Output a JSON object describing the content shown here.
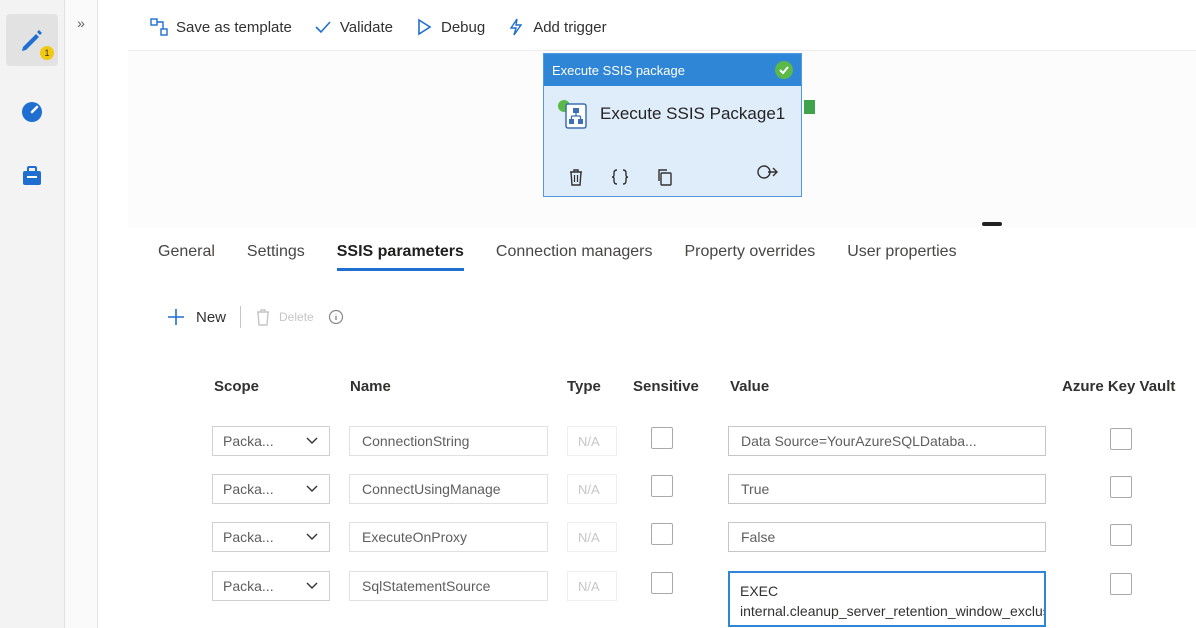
{
  "rail": {
    "badge": "1"
  },
  "toolbar": {
    "save_template": "Save as template",
    "validate": "Validate",
    "debug": "Debug",
    "add_trigger": "Add trigger"
  },
  "activity": {
    "type": "Execute SSIS package",
    "name": "Execute SSIS Package1"
  },
  "tabs": [
    {
      "label": "General"
    },
    {
      "label": "Settings"
    },
    {
      "label": "SSIS parameters"
    },
    {
      "label": "Connection managers"
    },
    {
      "label": "Property overrides"
    },
    {
      "label": "User properties"
    }
  ],
  "param_toolbar": {
    "new": "New",
    "delete": "Delete"
  },
  "columns": {
    "scope": "Scope",
    "name": "Name",
    "type": "Type",
    "sensitive": "Sensitive",
    "value": "Value",
    "akv": "Azure Key Vault"
  },
  "rows": [
    {
      "scope": "Packa...",
      "name": "ConnectionString",
      "type": "N/A",
      "value": "Data Source=YourAzureSQLDataba..."
    },
    {
      "scope": "Packa...",
      "name": "ConnectUsingManage",
      "type": "N/A",
      "value": "True"
    },
    {
      "scope": "Packa...",
      "name": "ExecuteOnProxy",
      "type": "N/A",
      "value": "False"
    },
    {
      "scope": "Packa...",
      "name": "SqlStatementSource",
      "type": "N/A",
      "value": "EXEC internal.cleanup_server_retention_window_exclusive"
    }
  ],
  "colors": {
    "accent": "#2f86d6",
    "card_bg": "#dfedfb",
    "success": "#5bb947",
    "badge": "#f2c811"
  }
}
